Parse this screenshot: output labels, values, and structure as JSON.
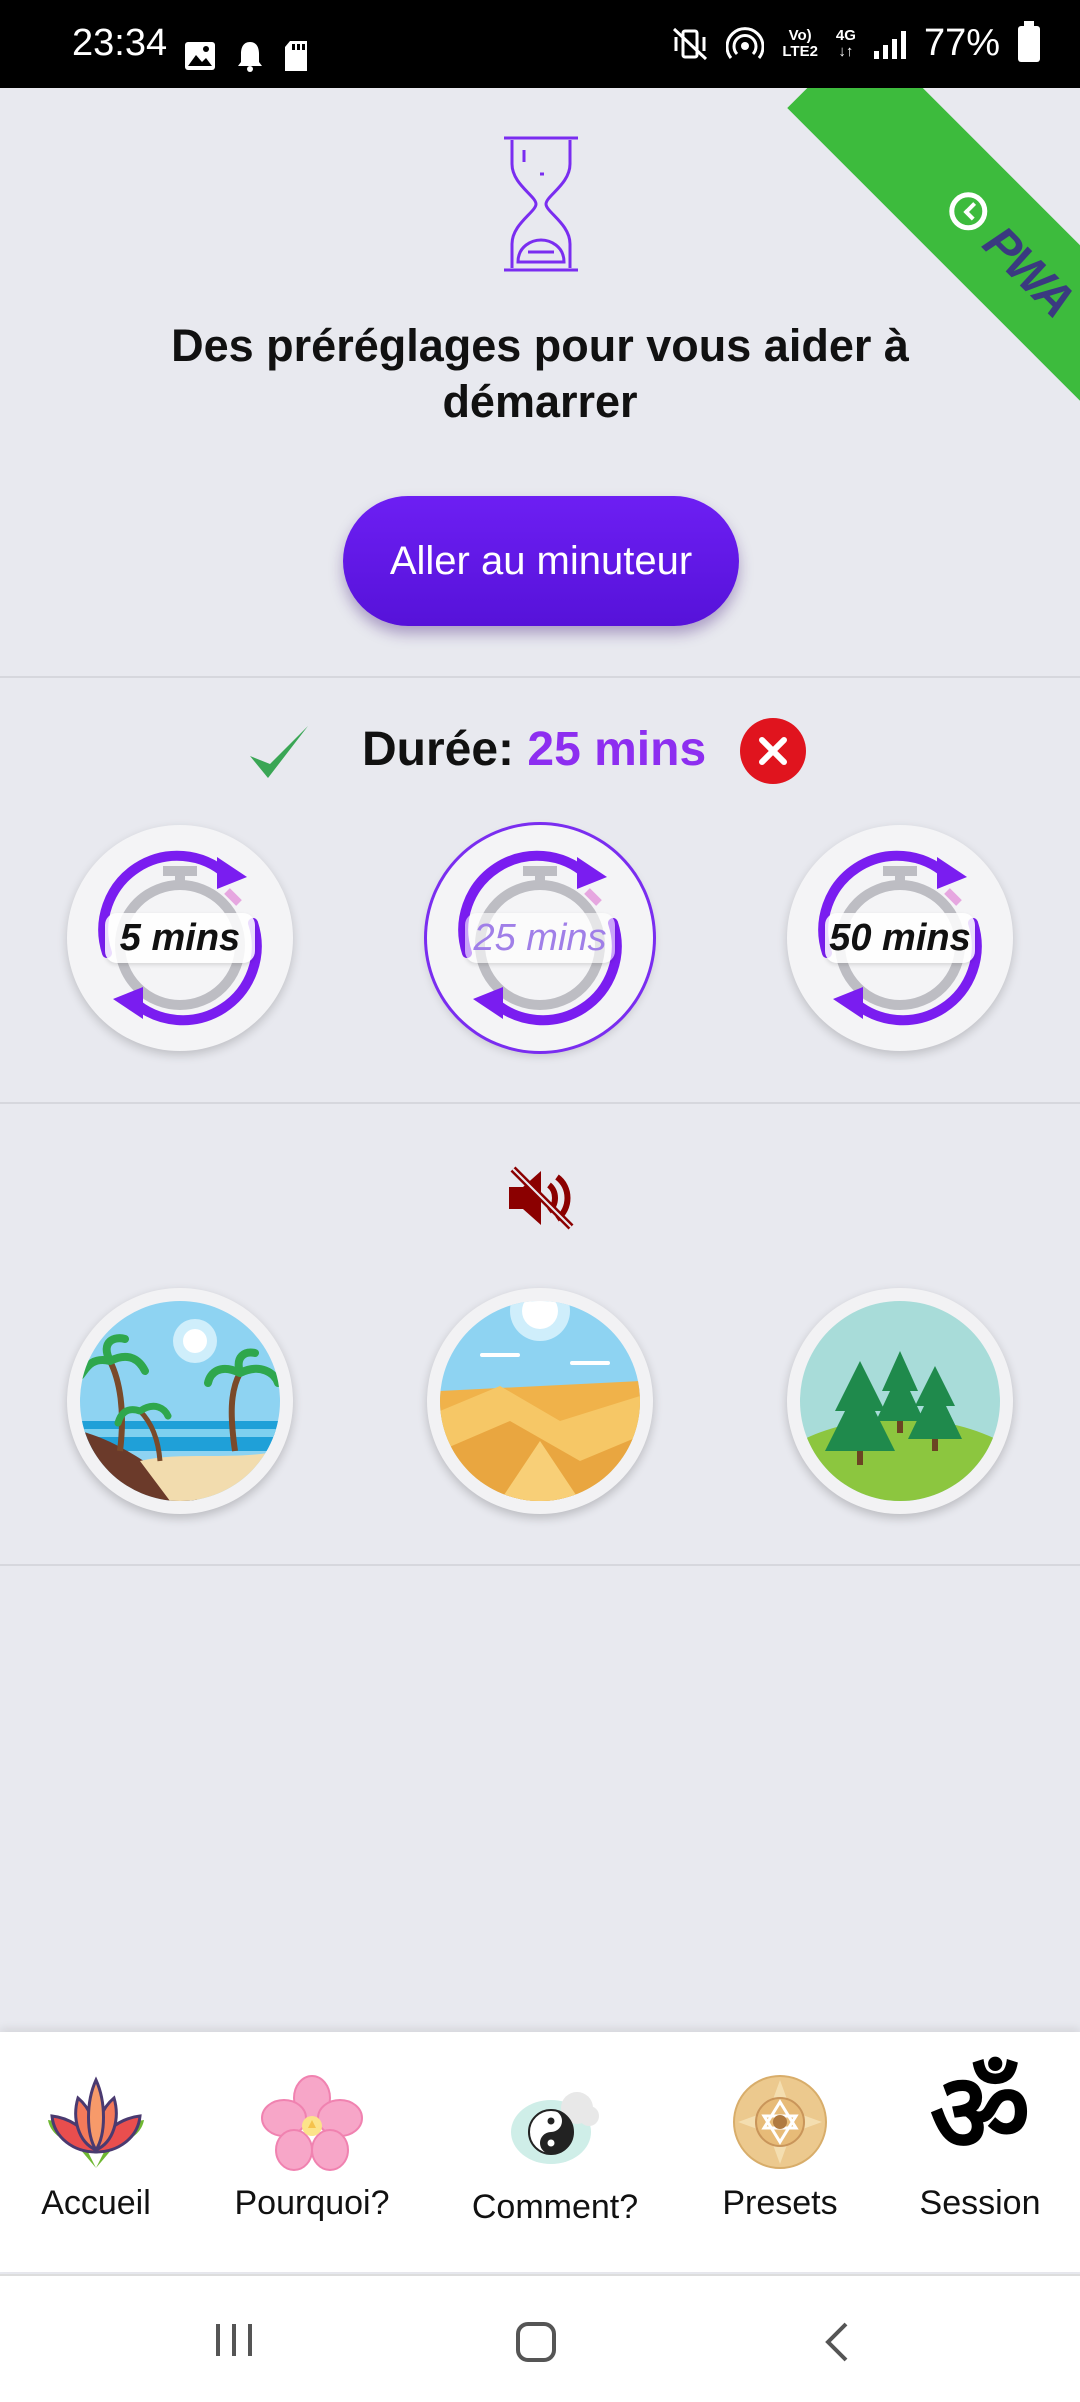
{
  "status_bar": {
    "time": "23:34",
    "network": "4G",
    "lte_top": "Vo)",
    "lte_bottom": "LTE2",
    "battery": "77%"
  },
  "ribbon": {
    "text": "PWA",
    "color": "#3dbb3d"
  },
  "header": {
    "icon": "hourglass-icon",
    "title": "Des préréglages pour vous aider à démarrer",
    "timer_button": "Aller au minuteur"
  },
  "duration": {
    "label": "Durée:",
    "value": "25 mins",
    "accent": "#8d2ef0"
  },
  "presets": [
    {
      "label": "5 mins",
      "selected": false
    },
    {
      "label": "25 mins",
      "selected": true
    },
    {
      "label": "50 mins",
      "selected": false
    }
  ],
  "sound": {
    "icon": "sound-muted-icon",
    "color": "#8b0000"
  },
  "scenes": [
    {
      "icon": "beach-scene-icon"
    },
    {
      "icon": "desert-scene-icon"
    },
    {
      "icon": "forest-scene-icon"
    }
  ],
  "bottom_nav": [
    {
      "label": "Accueil",
      "icon": "lotus-icon"
    },
    {
      "label": "Pourquoi?",
      "icon": "flower-icon"
    },
    {
      "label": "Comment?",
      "icon": "yin-yang-icon"
    },
    {
      "label": "Presets",
      "icon": "mandala-icon"
    },
    {
      "label": "Session",
      "icon": "om-icon"
    }
  ]
}
